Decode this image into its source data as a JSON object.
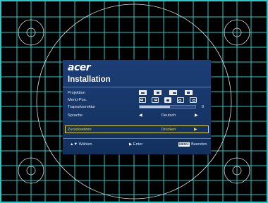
{
  "logo": "acer",
  "menu": {
    "title": "Installation",
    "rows": [
      {
        "label": "Projektion"
      },
      {
        "label": "Menü-Pos."
      },
      {
        "label": "Trapezkorrektur",
        "level": 0.55,
        "value": "0"
      },
      {
        "label": "Sprache",
        "value": "Deutsch"
      },
      {
        "label": "Zurücksetzen",
        "value": "Drücken",
        "selected": true
      }
    ]
  },
  "footer": {
    "select_symbol": "▲▼",
    "select_label": "Wählen",
    "enter_symbol": "▶",
    "enter_label": "Enter",
    "menu_key": "MENU",
    "exit_label": "Beenden"
  },
  "colors": {
    "osd_background": "#1c3e76",
    "highlight": "#f0d838",
    "grid": "#29c9c9"
  },
  "icons": [
    "projection-mode-icon",
    "menu-position-icon",
    "arrow-left-icon",
    "arrow-right-icon"
  ]
}
